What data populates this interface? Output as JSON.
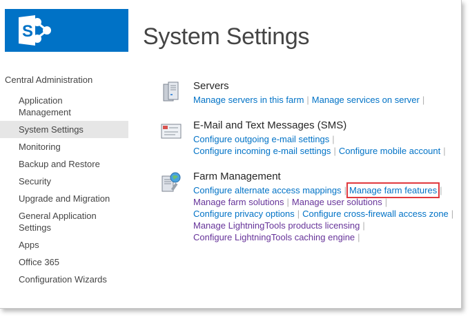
{
  "page": {
    "title": "System Settings"
  },
  "nav": {
    "root": "Central Administration",
    "items": [
      {
        "label": "Application Management",
        "lines": [
          "Application",
          "Management"
        ],
        "selected": false
      },
      {
        "label": "System Settings",
        "lines": [
          "System Settings"
        ],
        "selected": true
      },
      {
        "label": "Monitoring",
        "lines": [
          "Monitoring"
        ],
        "selected": false
      },
      {
        "label": "Backup and Restore",
        "lines": [
          "Backup and Restore"
        ],
        "selected": false
      },
      {
        "label": "Security",
        "lines": [
          "Security"
        ],
        "selected": false
      },
      {
        "label": "Upgrade and Migration",
        "lines": [
          "Upgrade and Migration"
        ],
        "selected": false
      },
      {
        "label": "General Application Settings",
        "lines": [
          "General Application",
          "Settings"
        ],
        "selected": false
      },
      {
        "label": "Apps",
        "lines": [
          "Apps"
        ],
        "selected": false
      },
      {
        "label": "Office 365",
        "lines": [
          "Office 365"
        ],
        "selected": false
      },
      {
        "label": "Configuration Wizards",
        "lines": [
          "Configuration Wizards"
        ],
        "selected": false
      }
    ]
  },
  "sections": {
    "servers": {
      "heading": "Servers",
      "icon": "servers-icon",
      "rows": [
        [
          {
            "text": "Manage servers in this farm",
            "visited": false,
            "highlight": false
          },
          {
            "text": "Manage services on server",
            "visited": false,
            "highlight": false
          }
        ]
      ]
    },
    "email": {
      "heading": "E-Mail and Text Messages (SMS)",
      "icon": "email-icon",
      "rows": [
        [
          {
            "text": "Configure outgoing e-mail settings",
            "visited": false,
            "highlight": false
          }
        ],
        [
          {
            "text": "Configure incoming e-mail settings",
            "visited": false,
            "highlight": false
          },
          {
            "text": "Configure mobile account",
            "visited": false,
            "highlight": false
          }
        ]
      ]
    },
    "farm": {
      "heading": "Farm Management",
      "icon": "farm-management-icon",
      "rows": [
        [
          {
            "text": "Configure alternate access mappings",
            "visited": false,
            "highlight": false
          },
          {
            "text": "Manage farm features",
            "visited": false,
            "highlight": true
          }
        ],
        [
          {
            "text": "Manage farm solutions",
            "visited": true,
            "highlight": false
          },
          {
            "text": "Manage user solutions",
            "visited": true,
            "highlight": false
          }
        ],
        [
          {
            "text": "Configure privacy options",
            "visited": false,
            "highlight": false
          },
          {
            "text": "Configure cross-firewall access zone",
            "visited": false,
            "highlight": false
          }
        ],
        [
          {
            "text": "Manage LightningTools products licensing",
            "visited": true,
            "highlight": false
          }
        ],
        [
          {
            "text": "Configure LightningTools caching engine",
            "visited": true,
            "highlight": false
          }
        ]
      ]
    }
  },
  "colors": {
    "brand_blue": "#0072c6",
    "link": "#0072c6",
    "visited_link": "#663399",
    "highlight_box": "#e0393e",
    "selected_nav": "#e6e6e6"
  }
}
